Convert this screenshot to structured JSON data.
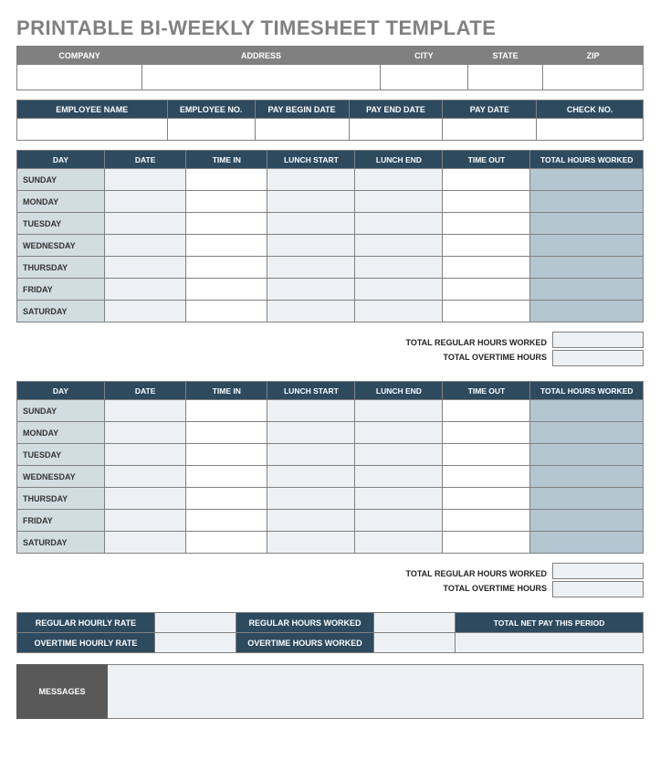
{
  "title": "PRINTABLE BI-WEEKLY TIMESHEET TEMPLATE",
  "company_headers": [
    "COMPANY",
    "ADDRESS",
    "CITY",
    "STATE",
    "ZIP"
  ],
  "company_values": [
    "",
    "",
    "",
    "",
    ""
  ],
  "employee_headers": [
    "EMPLOYEE NAME",
    "EMPLOYEE NO.",
    "PAY BEGIN DATE",
    "PAY END DATE",
    "PAY DATE",
    "CHECK NO."
  ],
  "employee_values": [
    "",
    "",
    "",
    "",
    "",
    ""
  ],
  "week_headers": [
    "DAY",
    "DATE",
    "TIME IN",
    "LUNCH START",
    "LUNCH END",
    "TIME OUT",
    "TOTAL HOURS WORKED"
  ],
  "days": [
    "SUNDAY",
    "MONDAY",
    "TUESDAY",
    "WEDNESDAY",
    "THURSDAY",
    "FRIDAY",
    "SATURDAY"
  ],
  "totals": {
    "regular_label": "TOTAL REGULAR HOURS WORKED",
    "overtime_label": "TOTAL OVERTIME HOURS",
    "regular_value": "",
    "overtime_value": ""
  },
  "pay": {
    "reg_rate_label": "REGULAR HOURLY RATE",
    "reg_hours_label": "REGULAR HOURS WORKED",
    "ot_rate_label": "OVERTIME HOURLY RATE",
    "ot_hours_label": "OVERTIME HOURS WORKED",
    "net_label": "TOTAL NET PAY THIS PERIOD",
    "reg_rate": "",
    "reg_hours": "",
    "ot_rate": "",
    "ot_hours": "",
    "net": ""
  },
  "messages_label": "MESSAGES",
  "messages_value": ""
}
